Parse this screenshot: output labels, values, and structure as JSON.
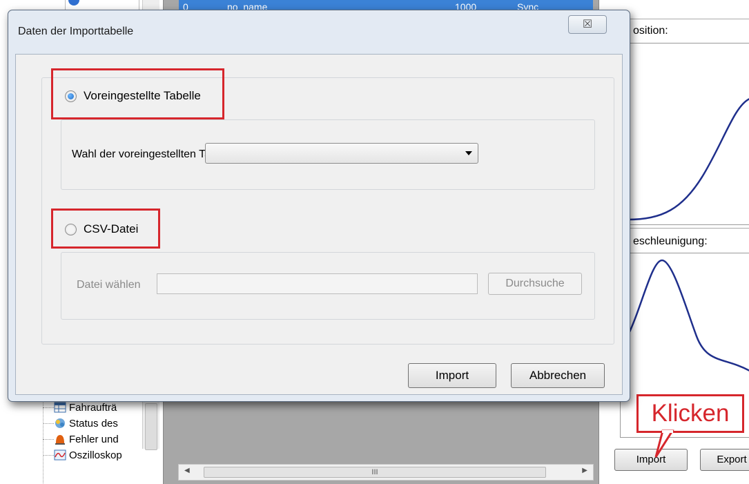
{
  "background": {
    "tree_items": [
      {
        "label": "Fahraufträ",
        "icon": "table-icon"
      },
      {
        "label": "Status des",
        "icon": "status-icon"
      },
      {
        "label": "Fehler und",
        "icon": "alarm-light-icon"
      },
      {
        "label": "Oszilloskop",
        "icon": "oscilloscope-icon"
      }
    ],
    "grid_header": {
      "c1": "0",
      "c2": "no_name",
      "c3": "1000",
      "c4": "Sync"
    },
    "hscroll_thumb_grip": "III",
    "position_label": "osition:",
    "acceleration_label": "eschleunigung:",
    "import_button": "Import",
    "export_button": "Export",
    "callout_text": "Klicken"
  },
  "dialog": {
    "title": "Daten der Importtabelle",
    "close_glyph": "☒",
    "option_preset": {
      "label": "Voreingestellte Tabelle",
      "selected": true
    },
    "preset_select_label": "Wahl der voreingestellten Tabelle:",
    "preset_select_value": "",
    "option_csv": {
      "label": "CSV-Datei",
      "selected": false
    },
    "csv_file_label": "Datei wählen",
    "csv_file_value": "",
    "browse_button": "Durchsuche",
    "import_button": "Import",
    "cancel_button": "Abbrechen"
  },
  "colors": {
    "highlight": "#d6262c",
    "grid_selection": "#3b82d6",
    "curve": "#1f2f8c"
  }
}
